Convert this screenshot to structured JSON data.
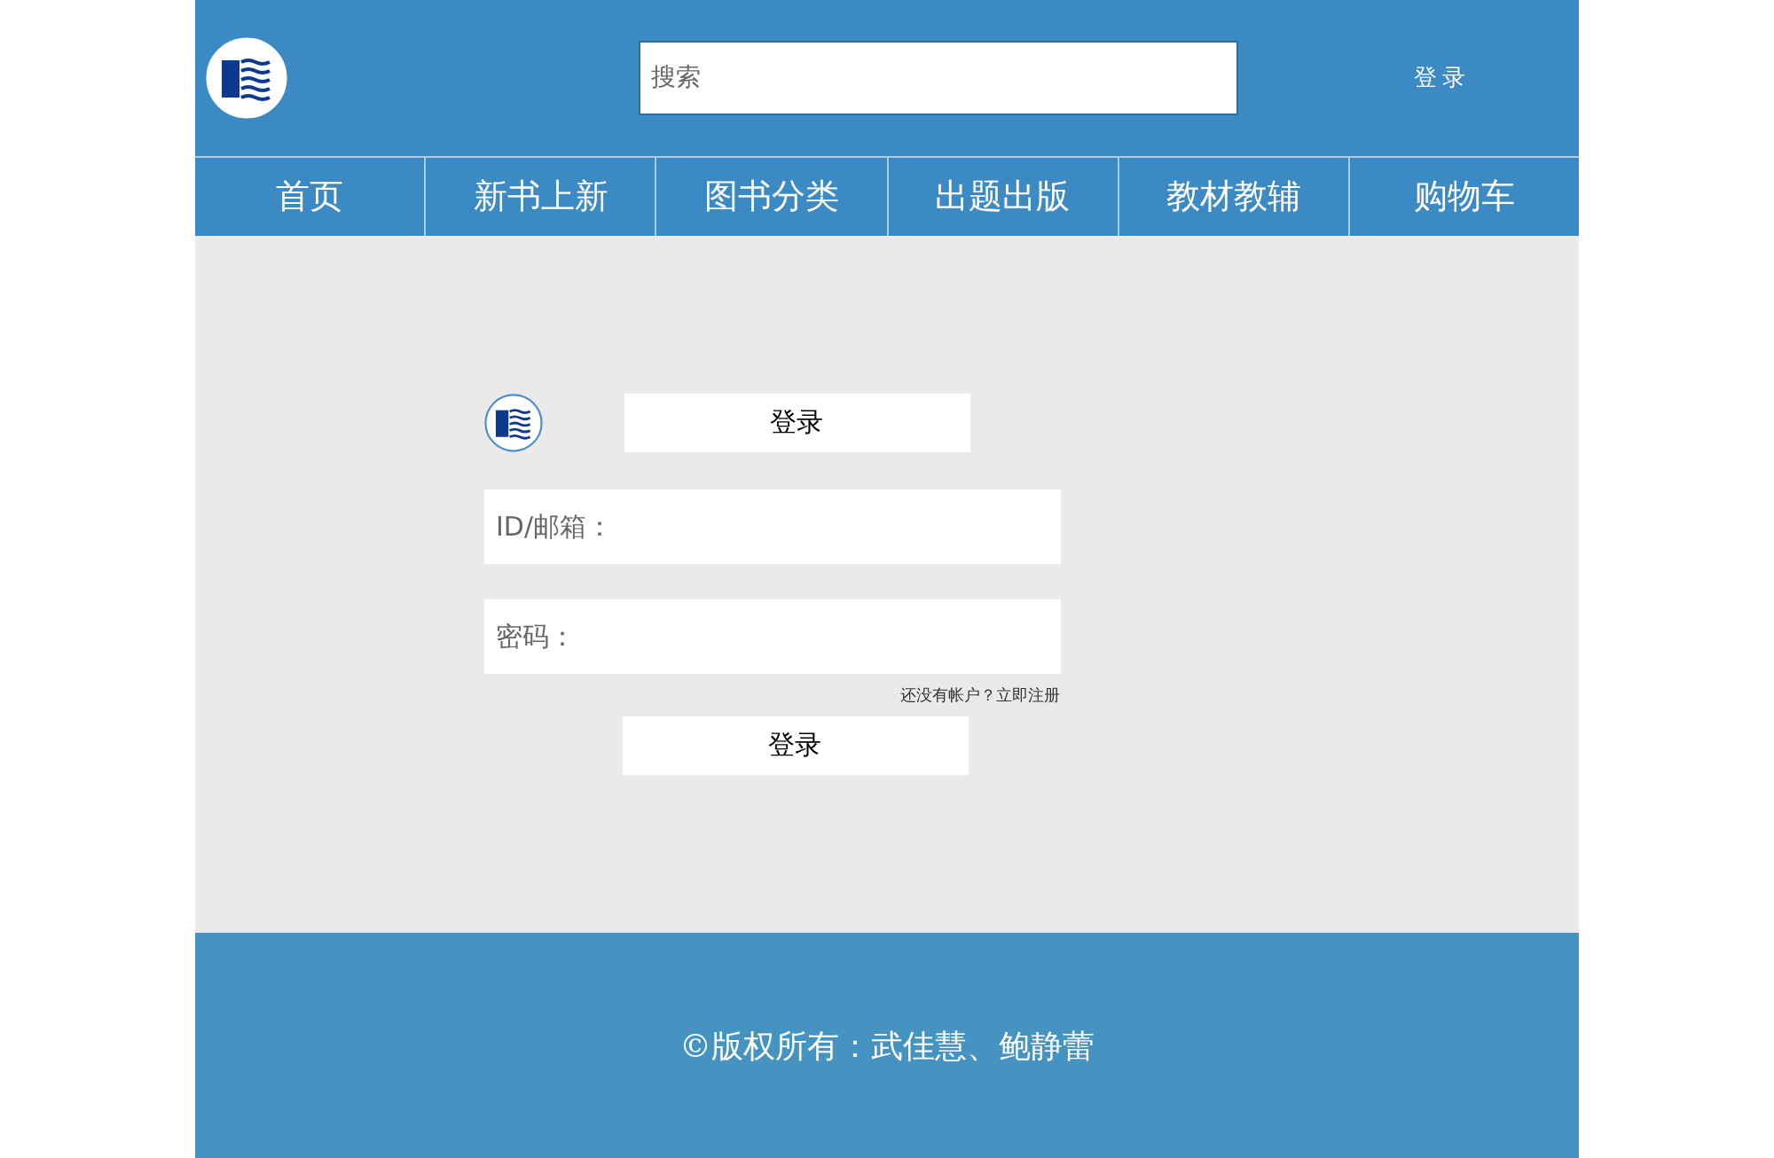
{
  "header": {
    "search": {
      "placeholder": "搜索"
    },
    "login_link": "登录"
  },
  "nav": [
    {
      "label": "首页"
    },
    {
      "label": "新书上新"
    },
    {
      "label": "图书分类"
    },
    {
      "label": "出题出版"
    },
    {
      "label": "教材教辅"
    },
    {
      "label": "购物车"
    }
  ],
  "login": {
    "title": "登录",
    "fields": [
      {
        "placeholder": "ID/邮箱："
      },
      {
        "placeholder": "密码："
      }
    ],
    "register_link": "还没有帐户？立即注册",
    "submit": "登录"
  },
  "footer": {
    "copyright": "©版权所有：武佳慧、鲍静蕾"
  }
}
